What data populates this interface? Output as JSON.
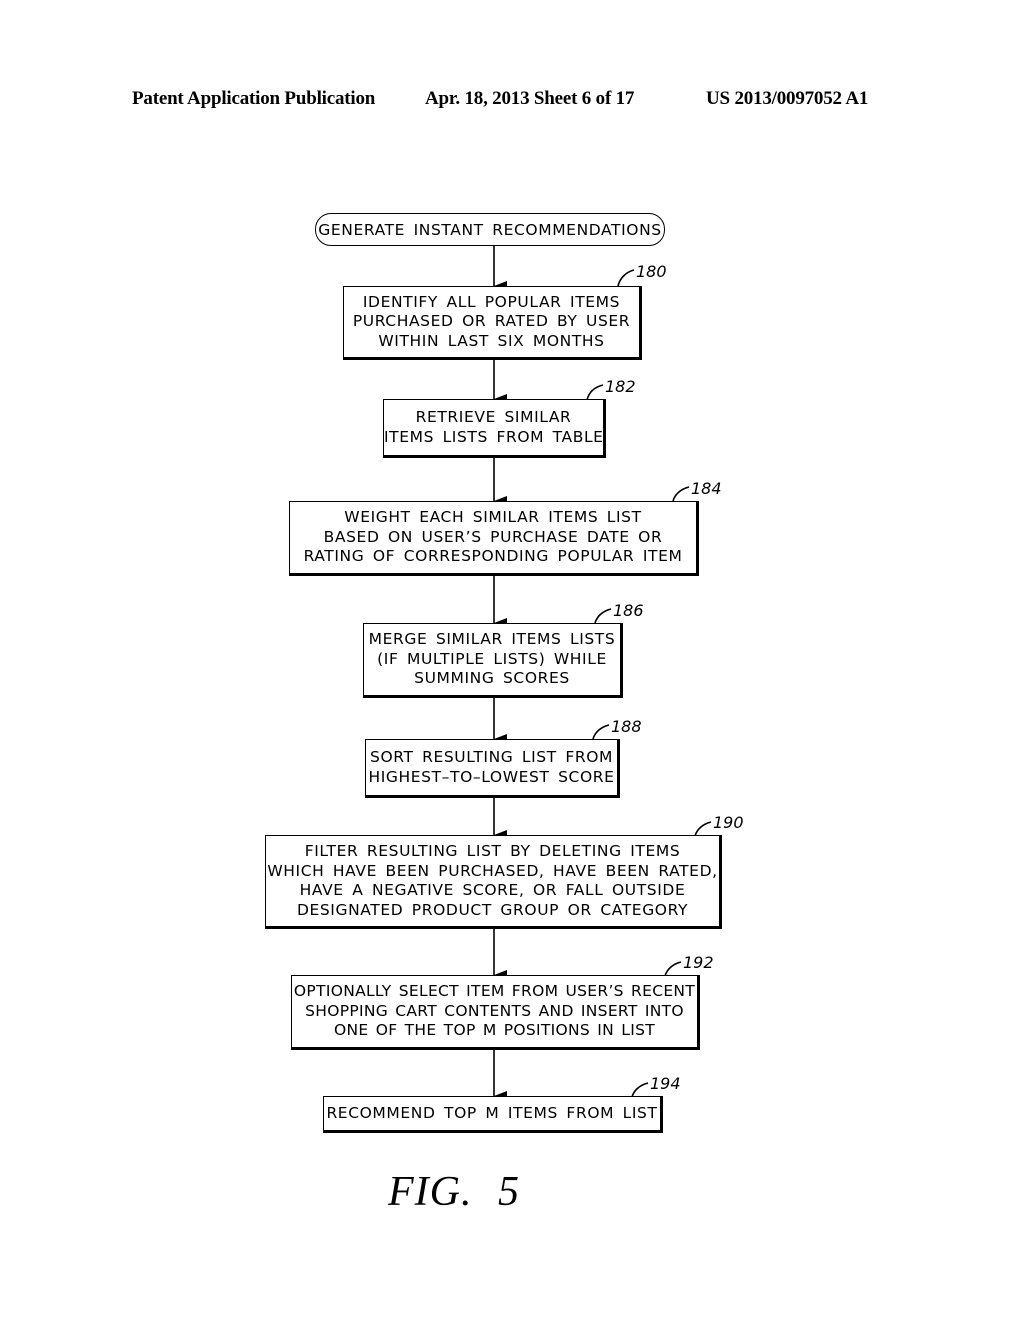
{
  "header": {
    "publication": "Patent Application Publication",
    "date_sheet": "Apr. 18, 2013  Sheet 6 of 17",
    "patent_number": "US 2013/0097052 A1"
  },
  "start": {
    "label": "GENERATE INSTANT RECOMMENDATIONS"
  },
  "steps": [
    {
      "ref": "180",
      "lines": [
        "IDENTIFY ALL POPULAR ITEMS",
        "PURCHASED OR RATED BY USER",
        "WITHIN LAST SIX MONTHS"
      ]
    },
    {
      "ref": "182",
      "lines": [
        "RETRIEVE SIMILAR",
        "ITEMS LISTS FROM TABLE"
      ]
    },
    {
      "ref": "184",
      "lines": [
        "WEIGHT EACH SIMILAR ITEMS LIST",
        "BASED ON USER’S PURCHASE DATE OR",
        "RATING OF CORRESPONDING POPULAR ITEM"
      ]
    },
    {
      "ref": "186",
      "lines": [
        "MERGE SIMILAR ITEMS LISTS",
        "(IF MULTIPLE LISTS) WHILE",
        "SUMMING SCORES"
      ]
    },
    {
      "ref": "188",
      "lines": [
        "SORT RESULTING LIST FROM",
        "HIGHEST–TO–LOWEST SCORE"
      ]
    },
    {
      "ref": "190",
      "lines": [
        "FILTER RESULTING LIST BY DELETING ITEMS",
        "WHICH HAVE BEEN PURCHASED, HAVE BEEN RATED,",
        "HAVE A NEGATIVE SCORE, OR FALL OUTSIDE",
        "DESIGNATED PRODUCT GROUP OR CATEGORY"
      ]
    },
    {
      "ref": "192",
      "lines": [
        "OPTIONALLY SELECT ITEM FROM USER’S RECENT",
        "SHOPPING CART CONTENTS AND INSERT INTO",
        "ONE OF THE TOP M POSITIONS IN LIST"
      ]
    },
    {
      "ref": "194",
      "lines": [
        "RECOMMEND TOP M ITEMS FROM LIST"
      ]
    }
  ],
  "figure_label": "FIG.  5"
}
